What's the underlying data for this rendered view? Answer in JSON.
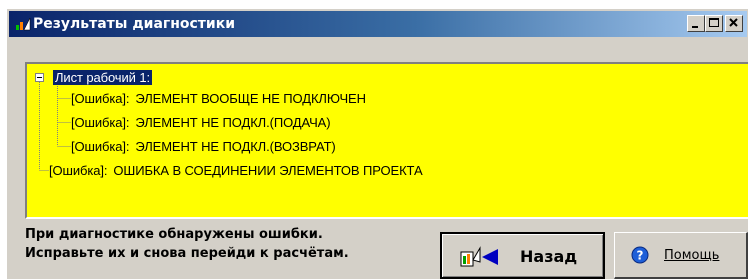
{
  "window": {
    "title": "Результаты диагностики",
    "controls": [
      "minimize-icon",
      "maximize-icon",
      "close-icon"
    ]
  },
  "tree": {
    "background": "#ffff00",
    "root": {
      "label": "Лист рабочий 1:",
      "expanded": true
    },
    "children": [
      {
        "tag": "[Ошибка]:",
        "text": "ЭЛЕМЕНТ ВООБЩЕ НЕ ПОДКЛЮЧЕН"
      },
      {
        "tag": "[Ошибка]:",
        "text": "ЭЛЕМЕНТ НЕ ПОДКЛ.(ПОДАЧА)"
      },
      {
        "tag": "[Ошибка]:",
        "text": "ЭЛЕМЕНТ НЕ ПОДКЛ.(ВОЗВРАТ)"
      }
    ],
    "top_level_item": {
      "tag": "[Ошибка]:",
      "text": "ОШИБКА В СОЕДИНЕНИИ ЭЛЕМЕНТОВ ПРОЕКТА"
    }
  },
  "message": {
    "line1": "При диагностике обнаружены ошибки.",
    "line2": "Исправьте их и снова перейди к расчётам."
  },
  "buttons": {
    "back": {
      "label": "Назад",
      "icon": "back-arrow-icon"
    },
    "help": {
      "label": "Помощь",
      "icon": "help-icon"
    }
  }
}
